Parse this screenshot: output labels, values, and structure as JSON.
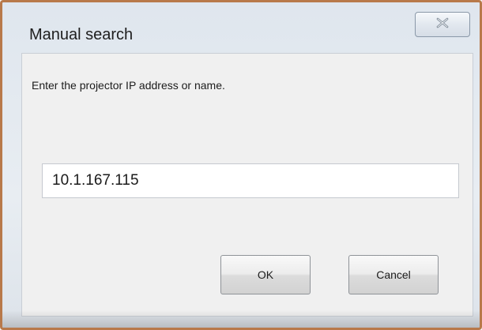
{
  "dialog": {
    "title": "Manual search",
    "close_icon": "close-x-icon"
  },
  "content": {
    "prompt": "Enter the projector IP address or name.",
    "ip_input_value": "10.1.167.115"
  },
  "buttons": {
    "ok_label": "OK",
    "cancel_label": "Cancel"
  },
  "colors": {
    "frame_border": "#b8794a",
    "client_background": "#f0f0f0"
  }
}
